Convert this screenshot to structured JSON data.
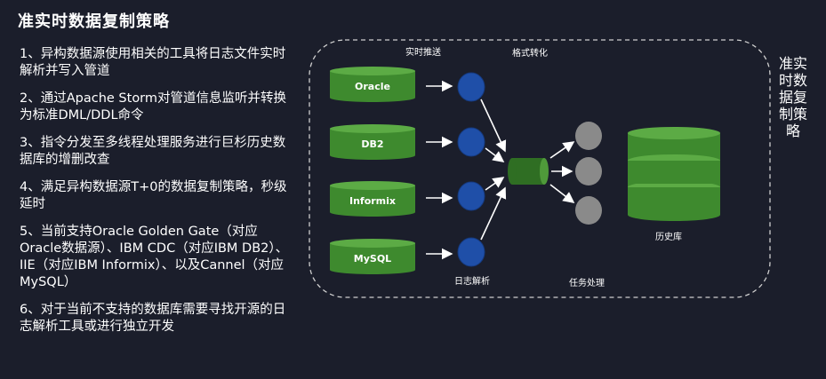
{
  "title": "准实时数据复制策略",
  "points": [
    "1、异构数据源使用相关的工具将日志文件实时解析并写入管道",
    "2、通过Apache Storm对管道信息监听并转换为标准DML/DDL命令",
    "3、指令分发至多线程处理服务进行巨杉历史数据库的增删改查",
    "4、满足异构数据源T+0的数据复制策略，秒级延时",
    "5、当前支持Oracle Golden Gate（对应Oracle数据源）、IBM CDC（对应IBM DB2）、IIE（对应IBM Informix）、以及Cannel（对应MySQL）",
    "6、对于当前不支持的数据库需要寻找开源的日志解析工具或进行独立开发"
  ],
  "diagram": {
    "side_label": "准实时数据复制策略",
    "sources": [
      "Oracle",
      "DB2",
      "Informix",
      "MySQL"
    ],
    "labels": {
      "realtime_push": "实时推送",
      "format_convert": "格式转化",
      "log_parse": "日志解析",
      "task_process": "任务处理",
      "history_db": "历史库"
    },
    "colors": {
      "db_green": "#3e8a2e",
      "db_top": "#5cab45",
      "node_blue": "#1f4fa8",
      "node_gray": "#8a8a8a",
      "pipe_green": "#2f6e23",
      "border": "#cfcfcf"
    }
  }
}
